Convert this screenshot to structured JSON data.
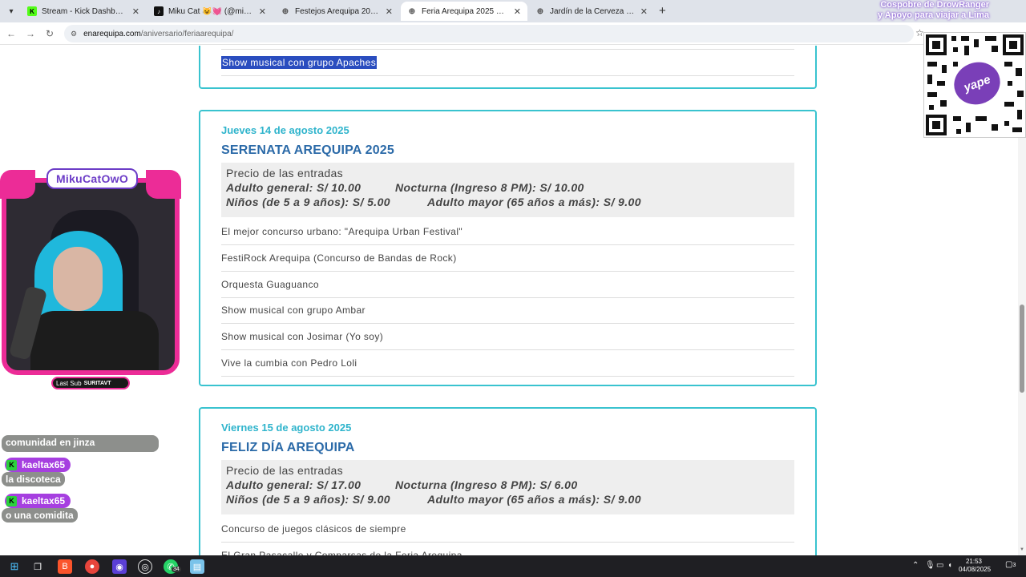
{
  "browser": {
    "tabs": [
      {
        "label": "Stream - Kick Dashboard",
        "icon": "kick-icon",
        "color": "#53fc18"
      },
      {
        "label": "Miku Cat 😺💓 (@mikucat",
        "icon": "tiktok-icon",
        "color": "#111111"
      },
      {
        "label": "Festejos Arequipa 2025 progra",
        "icon": "globe-icon",
        "color": "#666666"
      },
      {
        "label": "Feria Arequipa 2025 Feria Areq",
        "icon": "globe-icon",
        "color": "#666666"
      },
      {
        "label": "Jardín de la Cerveza 2025 Areq",
        "icon": "globe-icon",
        "color": "#666666"
      }
    ],
    "active_tab": 3,
    "new_tab_label": "+",
    "url_host": "enarequipa.com",
    "url_path": "/aniversario/feriaarequipa/"
  },
  "stream_overlay": {
    "banner_line1": "Cospobre de DrowRanger",
    "banner_line2": "y Apoyo para viajar a Lima",
    "qr_badge": "yape",
    "streamer_logo": "MikuCatOwO",
    "last_sub_label": "Last Sub",
    "last_sub_user": "SURITAVT"
  },
  "chat": [
    {
      "type": "message",
      "text": "comunidad en jinza"
    },
    {
      "type": "user",
      "text": "kaeltax65"
    },
    {
      "type": "message",
      "text": "la discoteca"
    },
    {
      "type": "user",
      "text": "kaeltax65"
    },
    {
      "type": "message",
      "text": "o una comidita"
    }
  ],
  "page": {
    "top_card_event": "Show musical con grupo Apaches",
    "cards": [
      {
        "date": "Jueves 14 de agosto 2025",
        "title": "SERENATA AREQUIPA 2025",
        "prices_title": "Precio de las entradas",
        "prices": [
          [
            "Adulto general: S/ 10.00",
            "Nocturna (Ingreso 8 PM): S/ 10.00"
          ],
          [
            "Niños (de 5 a 9 años): S/ 5.00",
            "Adulto mayor (65 años a más): S/ 9.00"
          ]
        ],
        "events": [
          "El mejor concurso urbano: \"Arequipa Urban Festival\"",
          "FestiRock Arequipa (Concurso de Bandas de Rock)",
          "Orquesta Guaguanco",
          "Show musical con grupo Ambar",
          "Show musical con Josimar (Yo soy)",
          "Vive la cumbia con Pedro Loli"
        ]
      },
      {
        "date": "Viernes 15 de agosto 2025",
        "title": "FELIZ DÍA AREQUIPA",
        "prices_title": "Precio de las entradas",
        "prices": [
          [
            "Adulto general: S/ 17.00",
            "Nocturna (Ingreso 8 PM): S/ 6.00"
          ],
          [
            "Niños (de 5 a 9 años): S/ 9.00",
            "Adulto mayor (65 años a más): S/ 9.00"
          ]
        ],
        "events": [
          "Concurso de juegos clásicos de siempre",
          "El Gran Pasacalle y Comparsas de la Feria Arequipa"
        ]
      }
    ]
  },
  "taskbar": {
    "whatsapp_badge": "34",
    "time": "21:53",
    "date": "04/08/2025",
    "notifications": "3"
  }
}
